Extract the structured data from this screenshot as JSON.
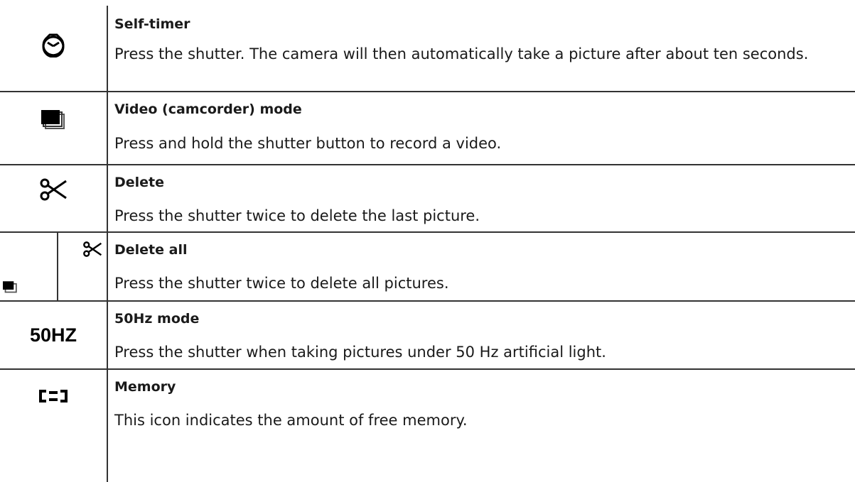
{
  "rows": [
    {
      "icon": "self-timer-icon",
      "title": "Self-timer",
      "description": "Press the shutter. The camera will then automatically take a picture after about ten seconds."
    },
    {
      "icon": "video-camcorder-icon",
      "title": "Video (camcorder) mode",
      "description": "Press and hold the shutter button to record a video."
    },
    {
      "icon": "scissors-icon",
      "title": "Delete",
      "description": "Press the shutter twice to delete the last picture."
    },
    {
      "icon": "delete-all-icon",
      "title": "Delete all",
      "description": "Press the shutter twice to delete all pictures."
    },
    {
      "icon": "50hz-icon",
      "icon_text": "50HZ",
      "title": "50Hz mode",
      "description": "Press the shutter when taking pictures under 50 Hz artificial light."
    },
    {
      "icon": "memory-icon",
      "title": "Memory",
      "description": "This icon indicates the amount of free memory."
    }
  ]
}
